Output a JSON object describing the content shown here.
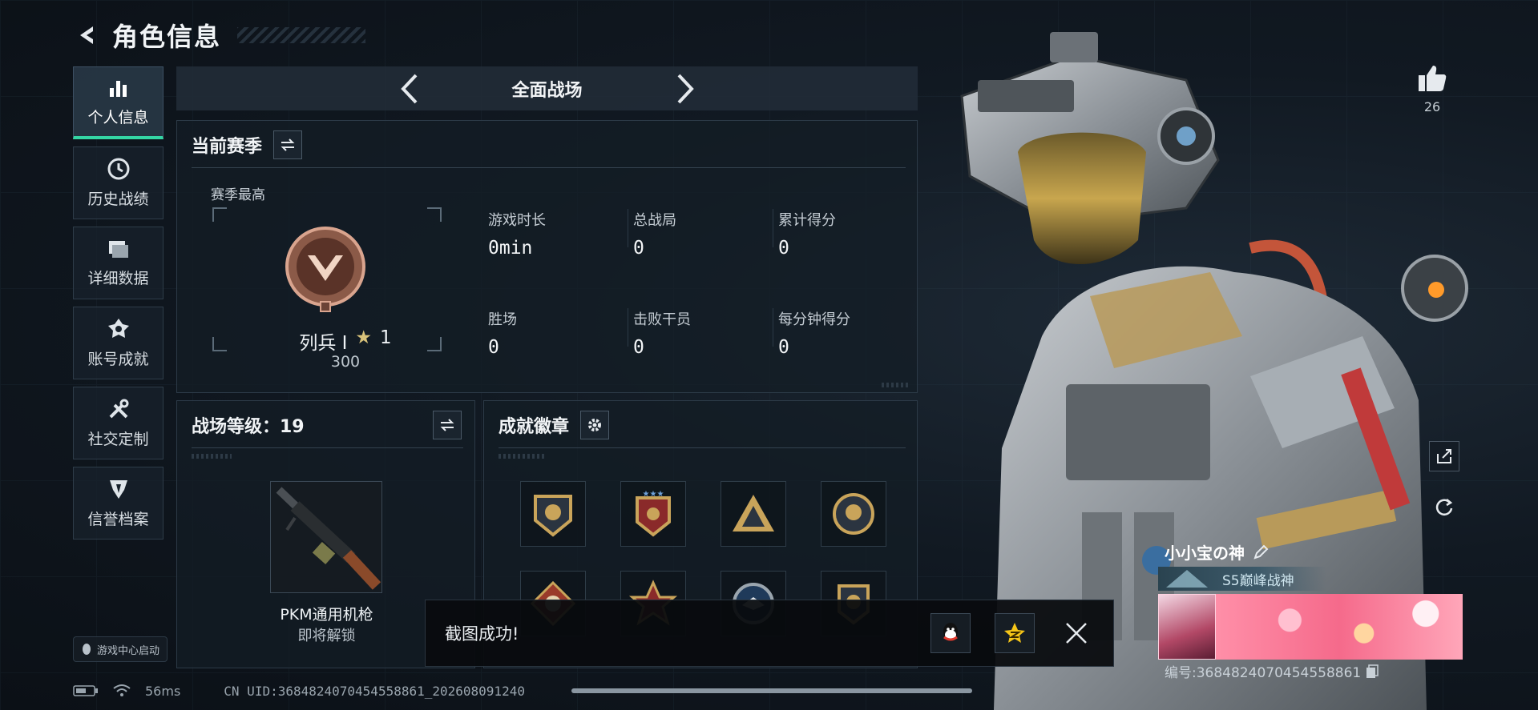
{
  "header": {
    "title": "角色信息"
  },
  "tabs": [
    {
      "label": "个人信息",
      "icon": "bar-chart-icon",
      "active": true
    },
    {
      "label": "历史战绩",
      "icon": "clock-icon",
      "active": false
    },
    {
      "label": "详细数据",
      "icon": "folder-icon",
      "active": false
    },
    {
      "label": "账号成就",
      "icon": "achievement-icon",
      "active": false
    },
    {
      "label": "社交定制",
      "icon": "tools-icon",
      "active": false
    },
    {
      "label": "信誉档案",
      "icon": "shield-icon",
      "active": false
    }
  ],
  "game_center": {
    "label": "游戏中心启动"
  },
  "mode": {
    "title": "全面战场"
  },
  "season": {
    "title": "当前赛季",
    "best_label": "赛季最高",
    "rank_name": "列兵 I",
    "rank_stars": "1",
    "rank_score": "300",
    "stats": [
      {
        "label": "游戏时长",
        "value": "0min"
      },
      {
        "label": "总战局",
        "value": "0"
      },
      {
        "label": "累计得分",
        "value": "0"
      },
      {
        "label": "胜场",
        "value": "0"
      },
      {
        "label": "击败干员",
        "value": "0"
      },
      {
        "label": "每分钟得分",
        "value": "0"
      }
    ]
  },
  "battlefield_level": {
    "title": "战场等级：19",
    "weapon_name": "PKM通用机枪",
    "weapon_status": "即将解锁"
  },
  "achievements": {
    "title": "成就徽章"
  },
  "toast": {
    "message": "截图成功!"
  },
  "status_bar": {
    "ping": "56ms",
    "uid": "CN UID:3684824070454558861_202608091240"
  },
  "profile": {
    "likes": "26",
    "name": "小小宝の神",
    "title_badge": "S5巅峰战神",
    "id_text": "编号:3684824070454558861"
  },
  "colors": {
    "accent": "#34d6a4",
    "bg": "#0d131a"
  }
}
